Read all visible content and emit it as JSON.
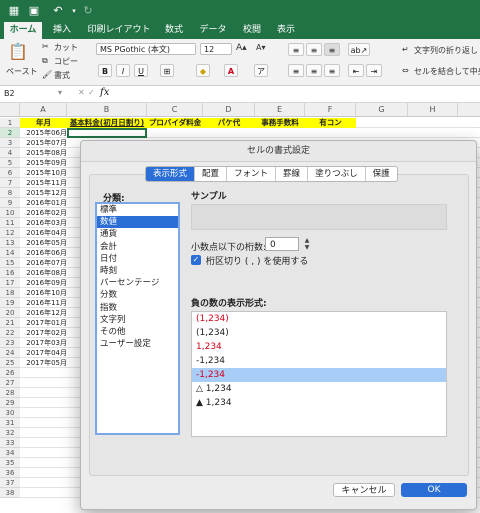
{
  "tabs": [
    "ホーム",
    "挿入",
    "印刷レイアウト",
    "数式",
    "データ",
    "校閲",
    "表示"
  ],
  "ribbon": {
    "paste": "ペースト",
    "cut": "カット",
    "copy": "コピー",
    "format_painter": "書式",
    "font_name": "MS PGothic (本文)",
    "font_size": "12",
    "wrap_text": "文字列の折り返し",
    "merge_center": "セルを結合して中央揃え"
  },
  "formula_bar": {
    "name_box": "B2",
    "fx": "fx",
    "value": ""
  },
  "columns": [
    "A",
    "B",
    "C",
    "D",
    "E",
    "F",
    "G",
    "H"
  ],
  "sheet_header": [
    "年月",
    "基本料金(初月日割り)",
    "プロバイダ料金",
    "パケ代",
    "事務手数料",
    "有コン"
  ],
  "rows": [
    "2015年06月",
    "2015年07月",
    "2015年08月",
    "2015年09月",
    "2015年10月",
    "2015年11月",
    "2015年12月",
    "2016年01月",
    "2016年02月",
    "2016年03月",
    "2016年04月",
    "2016年05月",
    "2016年06月",
    "2016年07月",
    "2016年08月",
    "2016年09月",
    "2016年10月",
    "2016年11月",
    "2016年12月",
    "2017年01月",
    "2017年02月",
    "2017年03月",
    "2017年04月",
    "2017年05月"
  ],
  "row_numbers": [
    "1",
    "2",
    "3",
    "4",
    "5",
    "6",
    "7",
    "8",
    "9",
    "10",
    "11",
    "12",
    "13",
    "14",
    "15",
    "16",
    "17",
    "18",
    "19",
    "20",
    "21",
    "22",
    "23",
    "24",
    "25",
    "26",
    "27",
    "28",
    "29",
    "30",
    "31",
    "32",
    "33",
    "34",
    "35",
    "36",
    "37",
    "38"
  ],
  "dialog": {
    "title": "セルの書式設定",
    "tabs": [
      "表示形式",
      "配置",
      "フォント",
      "罫線",
      "塗りつぶし",
      "保護"
    ],
    "category_label": "分類:",
    "categories": [
      "標準",
      "数値",
      "通貨",
      "会計",
      "日付",
      "時刻",
      "パーセンテージ",
      "分数",
      "指数",
      "文字列",
      "その他",
      "ユーザー設定"
    ],
    "sample_label": "サンプル",
    "decimal_label": "小数点以下の桁数:",
    "decimal_value": "0",
    "separator_label": "桁区切り ( , ) を使用する",
    "negative_label": "負の数の表示形式:",
    "negatives": [
      "(1,234)",
      "(1,234)",
      "1,234",
      "-1,234",
      "-1,234",
      "△ 1,234",
      "▲ 1,234"
    ],
    "cancel": "キャンセル",
    "ok": "OK"
  },
  "colors": {
    "excel_green": "#217346",
    "header_yellow": "#ffff00",
    "select_blue": "#2b6fd6",
    "negative_red": "#d0021b"
  }
}
